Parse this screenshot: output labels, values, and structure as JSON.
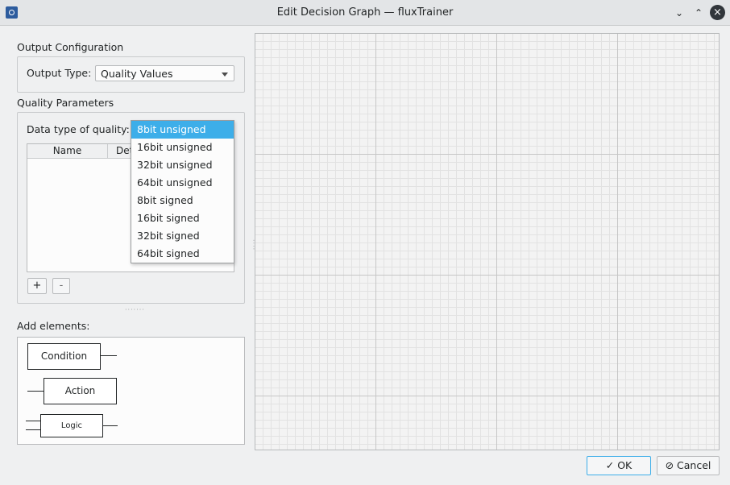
{
  "window": {
    "title": "Edit Decision Graph — fluxTrainer",
    "app_icon": "app-icon",
    "minimize_icon": "chevron-down-icon",
    "maximize_icon": "chevron-up-icon",
    "close_icon": "close-icon"
  },
  "output_config": {
    "group_label": "Output Configuration",
    "type_label": "Output Type:",
    "type_value": "Quality Values"
  },
  "quality_params": {
    "group_label": "Quality Parameters",
    "data_type_label": "Data type of quality:",
    "data_type_value": "8bit unsigned",
    "options": [
      "8bit unsigned",
      "16bit unsigned",
      "32bit unsigned",
      "64bit unsigned",
      "8bit signed",
      "16bit signed",
      "32bit signed",
      "64bit signed"
    ],
    "table_headers": [
      "Name",
      "Det"
    ],
    "add_label": "+",
    "remove_label": "-"
  },
  "palette": {
    "label": "Add elements:",
    "condition": "Condition",
    "action": "Action",
    "logic": "Logic"
  },
  "footer": {
    "ok_label": "OK",
    "cancel_label": "Cancel",
    "ok_icon": "check-icon",
    "cancel_icon": "cancel-icon"
  },
  "colors": {
    "accent": "#3daee9",
    "window_bg": "#eff0f1",
    "canvas_bg": "#f3f3f3"
  }
}
